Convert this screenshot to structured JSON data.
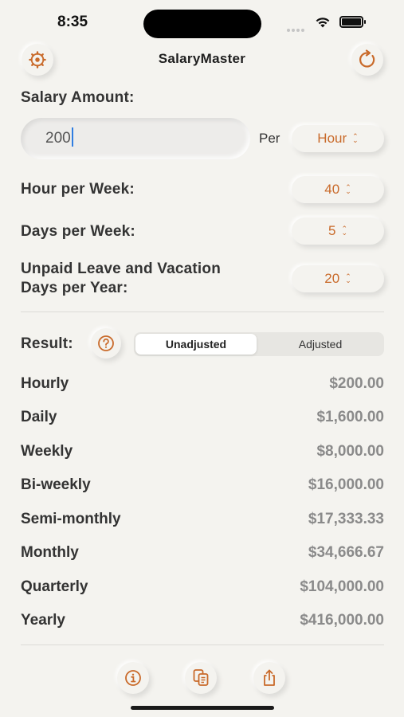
{
  "status": {
    "time": "8:35"
  },
  "header": {
    "title": "SalaryMaster",
    "settings_icon": "gear-icon",
    "reset_icon": "refresh-icon"
  },
  "salary": {
    "label": "Salary Amount:",
    "value": "200",
    "per_label": "Per",
    "period": "Hour"
  },
  "settings": {
    "hours_label": "Hour per Week:",
    "hours_value": "40",
    "days_label": "Days per Week:",
    "days_value": "5",
    "leave_label_line1": "Unpaid Leave and Vacation",
    "leave_label_line2": "Days per Year:",
    "leave_value": "20"
  },
  "result": {
    "label": "Result:",
    "tabs": [
      "Unadjusted",
      "Adjusted"
    ],
    "selected_tab": "Unadjusted",
    "rows": [
      {
        "label": "Hourly",
        "value": "$200.00"
      },
      {
        "label": "Daily",
        "value": "$1,600.00"
      },
      {
        "label": "Weekly",
        "value": "$8,000.00"
      },
      {
        "label": "Bi-weekly",
        "value": "$16,000.00"
      },
      {
        "label": "Semi-monthly",
        "value": "$17,333.33"
      },
      {
        "label": "Monthly",
        "value": "$34,666.67"
      },
      {
        "label": "Quarterly",
        "value": "$104,000.00"
      },
      {
        "label": "Yearly",
        "value": "$416,000.00"
      }
    ]
  },
  "footer": {
    "icons": [
      "info-icon",
      "copy-icon",
      "share-icon"
    ]
  },
  "colors": {
    "accent": "#c96a2a",
    "background": "#f4f3ef",
    "value_text": "#8a8a8a"
  }
}
